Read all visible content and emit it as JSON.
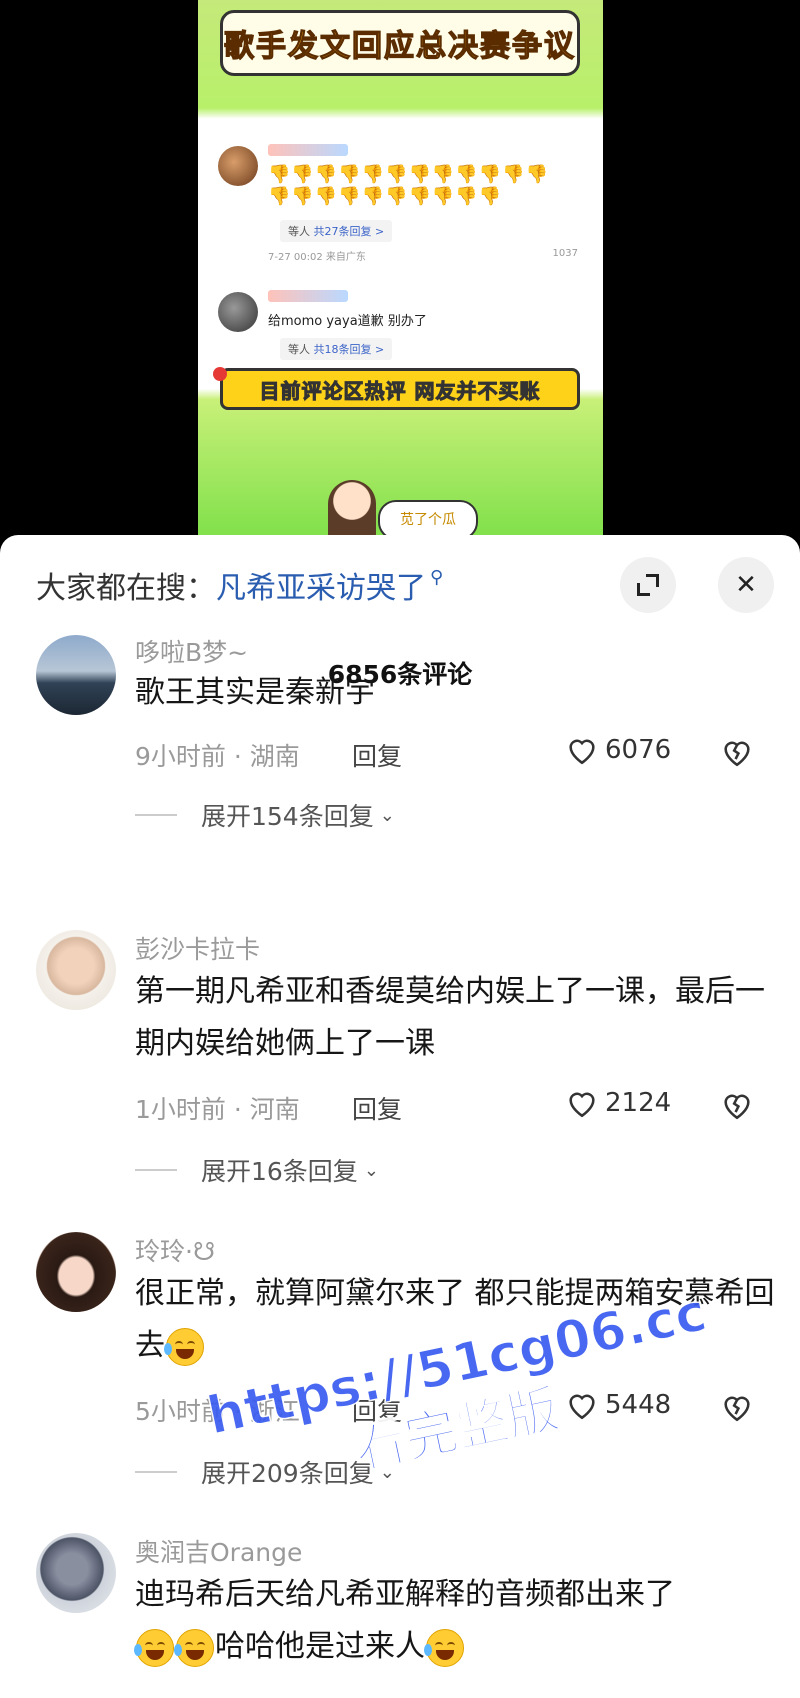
{
  "video": {
    "banner_title": "歌手发文回应总决赛争议",
    "mock_comment_1": {
      "emojis": "👎👎👎👎👎👎👎👎👎👎👎👎👎👎👎👎👎👎👎👎👎👎",
      "reply_prefix": "等人 ",
      "reply_count": "共27条回复 >",
      "meta_time": "7-27 00:02 来自广东",
      "meta_likes": "1037"
    },
    "mock_comment_2": {
      "text": "给momo yaya道歉 别办了",
      "reply_prefix": "等人 ",
      "reply_count": "共18条回复 >"
    },
    "yellow_banner": "目前评论区热评 网友并不买账",
    "mascot_bubble": "苋了个瓜"
  },
  "sheet": {
    "search_label": "大家都在搜：",
    "search_term": "凡希亚采访哭了",
    "count_title": "6856条评论"
  },
  "comments": [
    {
      "name": "哆啦B梦~",
      "text": "歌王其实是秦新宇",
      "meta": "9小时前 · 湖南",
      "reply": "回复",
      "likes": "6076",
      "expand": "展开154条回复"
    },
    {
      "name": "彭沙卡拉卡",
      "text": "第一期凡希亚和香缇莫给内娱上了一课，最后一期内娱给她俩上了一课",
      "meta": "1小时前 · 河南",
      "reply": "回复",
      "likes": "2124",
      "expand": "展开16条回复"
    },
    {
      "name": "玲玲·☋",
      "text": "很正常，就算阿黛尔来了 都只能提两箱安慕希回去",
      "meta": "5小时前 · 浙江",
      "reply": "回复",
      "likes": "5448",
      "expand": "展开209条回复"
    },
    {
      "name": "奥润吉Orange",
      "text": "迪玛希后天给凡希亚解释的音频都出来了",
      "text_tail": "哈哈他是过来人"
    }
  ],
  "watermark": {
    "line1": "https://51cg06.cc",
    "line2": "看完整版"
  },
  "icons": {
    "search": "magnifier-icon",
    "expand": "expand-icon",
    "close": "close-icon",
    "like": "heart-icon",
    "dislike": "broken-heart-icon",
    "chevron": "chevron-down-icon",
    "emoji": "laugh-cry-emoji-icon"
  }
}
